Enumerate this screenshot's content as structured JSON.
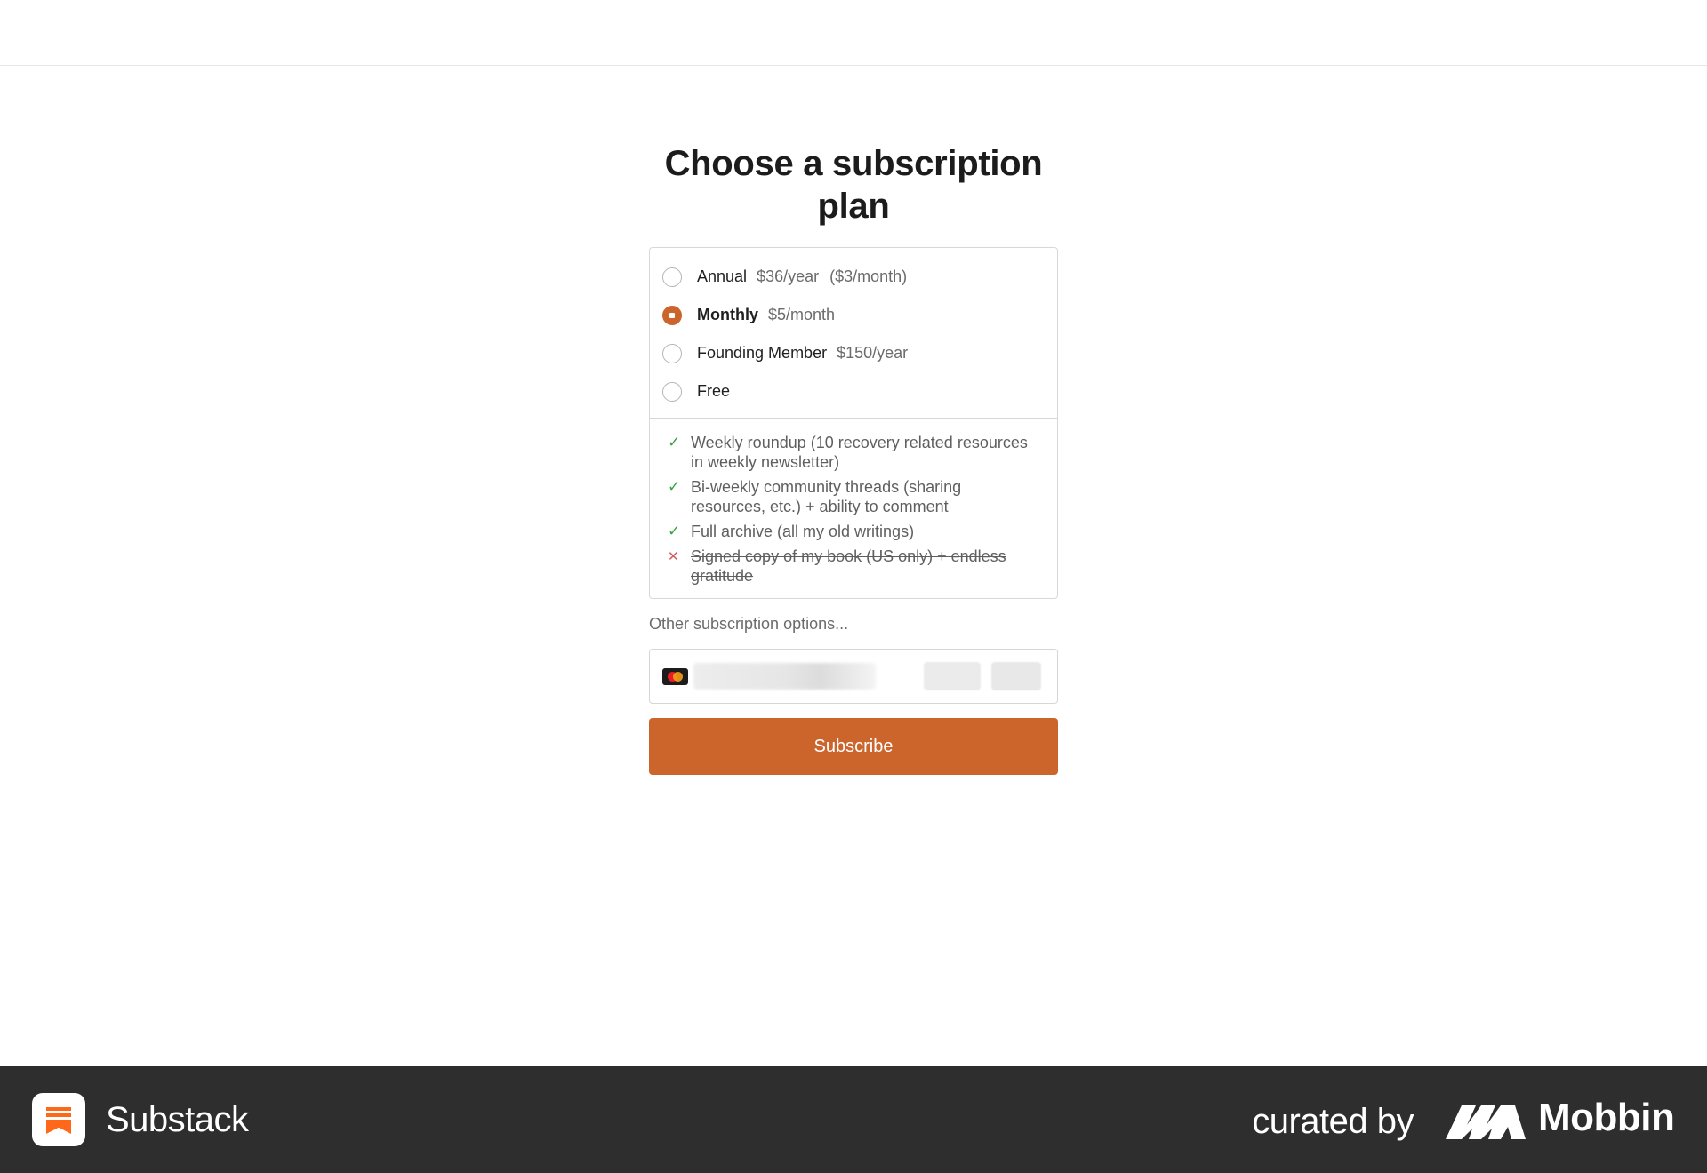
{
  "page": {
    "title": "Choose a subscription plan"
  },
  "plans": [
    {
      "name": "Annual",
      "price": "$36/year",
      "extra": "($3/month)",
      "selected": false
    },
    {
      "name": "Monthly",
      "price": "$5/month",
      "extra": "",
      "selected": true
    },
    {
      "name": "Founding Member",
      "price": "$150/year",
      "extra": "",
      "selected": false
    },
    {
      "name": "Free",
      "price": "",
      "extra": "",
      "selected": false
    }
  ],
  "features": [
    {
      "text": "Weekly roundup (10 recovery related resources in weekly newsletter)",
      "included": true,
      "icon": "check-icon"
    },
    {
      "text": "Bi-weekly community threads (sharing resources, etc.) + ability to comment",
      "included": true,
      "icon": "check-icon"
    },
    {
      "text": "Full archive (all my old writings)",
      "included": true,
      "icon": "check-icon"
    },
    {
      "text": "Signed copy of my book (US only) + endless gratitude",
      "included": false,
      "icon": "cross-icon"
    }
  ],
  "other_options_label": "Other subscription options...",
  "payment": {
    "card_brand_icon": "mastercard-icon"
  },
  "subscribe_label": "Subscribe",
  "footer": {
    "app_name": "Substack",
    "curated_by": "curated by",
    "curator": "Mobbin"
  },
  "colors": {
    "accent": "#cc652b",
    "check": "#3aa341",
    "cross": "#d45757",
    "footer_bg": "#2e2e2e",
    "substack_orange": "#ff6719"
  }
}
